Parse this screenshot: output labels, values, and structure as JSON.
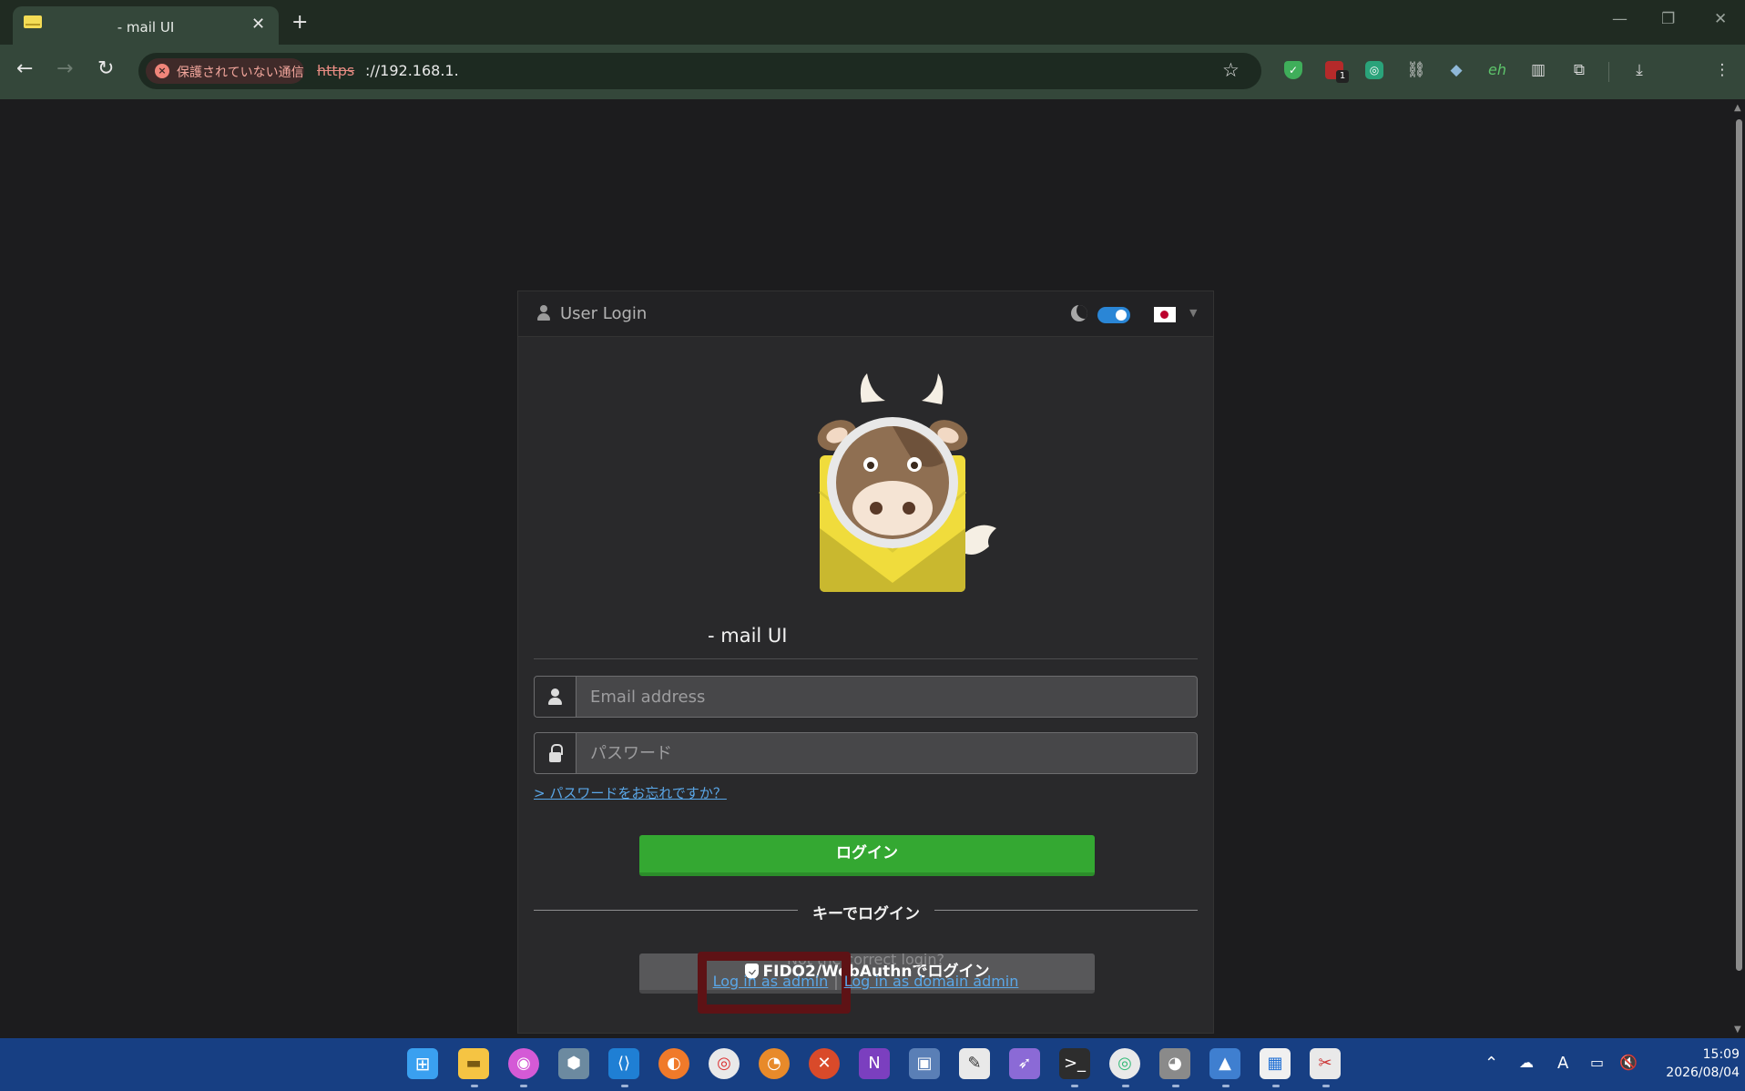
{
  "browser": {
    "tab_title": "- mail UI",
    "new_tab": "+",
    "tab_close": "✕",
    "security_label": "保護されていない通信",
    "url_scheme": "https",
    "url_rest": "://192.168.1.",
    "extension_badge": "1",
    "extension_eh": "eh"
  },
  "login": {
    "header_title": "User Login",
    "app_title": "- mail UI",
    "email_placeholder": "Email address",
    "password_placeholder": "パスワード",
    "forgot_link": "> パスワードをお忘れですか？",
    "login_button": "ログイン",
    "key_separator": "キーでログイン",
    "fido_button": "FIDO2/WebAuthnでログイン",
    "theme_toggle_on": true,
    "language_flag": "jp"
  },
  "below_card": {
    "not_correct": "Not the correct login?",
    "admin_link": "Log in as admin",
    "separator": "|",
    "domain_admin_link": "Log in as domain admin"
  },
  "taskbar": {
    "time": "15:09",
    "date": "2026/08/04",
    "ime": "A"
  },
  "colors": {
    "login_button": "#34a832",
    "link": "#5aa7e8",
    "taskbar": "#173f83",
    "highlight": "#5e1215"
  }
}
